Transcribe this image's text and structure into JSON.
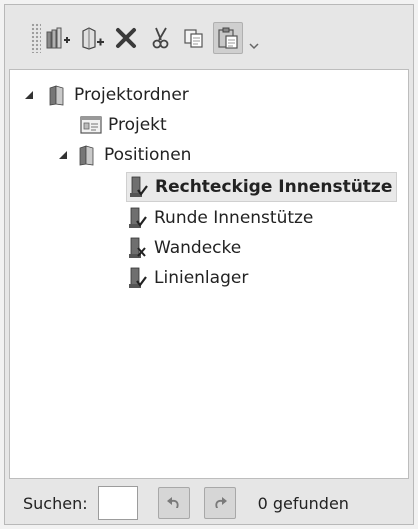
{
  "toolbar": {
    "buttons": [
      {
        "icon": "new-folder-icon"
      },
      {
        "icon": "new-item-icon"
      },
      {
        "icon": "delete-icon"
      },
      {
        "icon": "cut-icon"
      },
      {
        "icon": "copy-icon"
      },
      {
        "icon": "paste-icon",
        "active": true
      }
    ]
  },
  "tree": {
    "root": {
      "label": "Projektordner",
      "icon": "folder-icon",
      "expanded": true
    },
    "project": {
      "label": "Projekt",
      "icon": "project-window-icon"
    },
    "positions": {
      "label": "Positionen",
      "icon": "folder-icon",
      "expanded": true
    },
    "items": [
      {
        "label": "Rechteckige Innenstütze",
        "icon": "column-check-icon",
        "selected": true
      },
      {
        "label": "Runde Innenstütze",
        "icon": "column-check-icon"
      },
      {
        "label": "Wandecke",
        "icon": "column-x-icon"
      },
      {
        "label": "Linienlager",
        "icon": "column-check-icon"
      }
    ]
  },
  "search": {
    "label": "Suchen:",
    "value": "",
    "result": "0 gefunden"
  }
}
